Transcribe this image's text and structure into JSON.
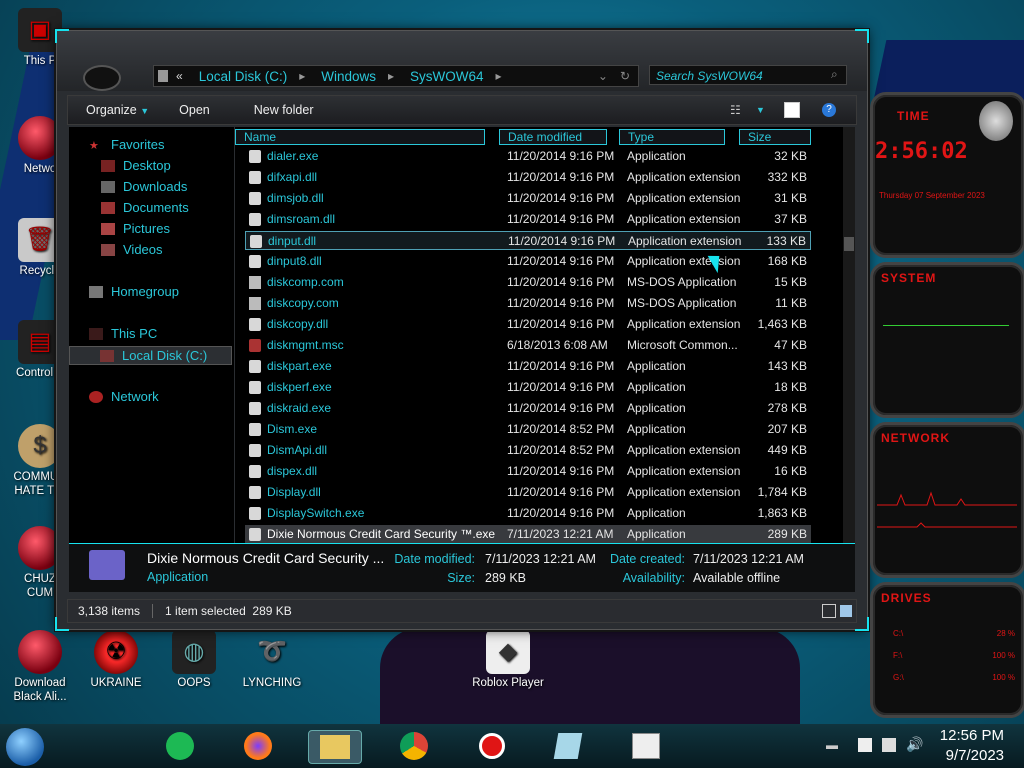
{
  "desktop": {
    "icons": [
      {
        "label": "This P",
        "sub": ""
      },
      {
        "label": "Netwo",
        "sub": ""
      },
      {
        "label": "Recycle",
        "sub": ""
      },
      {
        "label": "Control P",
        "sub": ""
      },
      {
        "label": "COMMUN",
        "sub": "HATE THI"
      },
      {
        "label": "CHUZ",
        "sub": "CUM"
      },
      {
        "label": "Download",
        "sub": "Black Ali..."
      },
      {
        "label": "UKRAINE",
        "sub": ""
      },
      {
        "label": "OOPS",
        "sub": ""
      },
      {
        "label": "LYNCHING",
        "sub": ""
      },
      {
        "label": "Roblox Player",
        "sub": ""
      }
    ]
  },
  "explorer": {
    "breadcrumb": {
      "root_arrow": "«",
      "segments": [
        "Local Disk (C:)",
        "Windows",
        "SysWOW64"
      ]
    },
    "search_placeholder": "Search SysWOW64",
    "toolbar": {
      "organize": "Organize",
      "open": "Open",
      "new_folder": "New folder"
    },
    "nav": {
      "favorites": "Favorites",
      "desktop": "Desktop",
      "downloads": "Downloads",
      "documents": "Documents",
      "pictures": "Pictures",
      "videos": "Videos",
      "homegroup": "Homegroup",
      "this_pc": "This PC",
      "local_disk": "Local Disk (C:)",
      "network": "Network"
    },
    "columns": {
      "name": "Name",
      "date": "Date modified",
      "type": "Type",
      "size": "Size"
    },
    "files": [
      {
        "name": "dialer.exe",
        "date": "11/20/2014 9:16 PM",
        "type": "Application",
        "size": "32 KB",
        "kind": "exe"
      },
      {
        "name": "difxapi.dll",
        "date": "11/20/2014 9:16 PM",
        "type": "Application extension",
        "size": "332 KB",
        "kind": "dll"
      },
      {
        "name": "dimsjob.dll",
        "date": "11/20/2014 9:16 PM",
        "type": "Application extension",
        "size": "31 KB",
        "kind": "dll"
      },
      {
        "name": "dimsroam.dll",
        "date": "11/20/2014 9:16 PM",
        "type": "Application extension",
        "size": "37 KB",
        "kind": "dll"
      },
      {
        "name": "dinput.dll",
        "date": "11/20/2014 9:16 PM",
        "type": "Application extension",
        "size": "133 KB",
        "kind": "dll"
      },
      {
        "name": "dinput8.dll",
        "date": "11/20/2014 9:16 PM",
        "type": "Application extension",
        "size": "168 KB",
        "kind": "dll"
      },
      {
        "name": "diskcomp.com",
        "date": "11/20/2014 9:16 PM",
        "type": "MS-DOS Application",
        "size": "15 KB",
        "kind": "com"
      },
      {
        "name": "diskcopy.com",
        "date": "11/20/2014 9:16 PM",
        "type": "MS-DOS Application",
        "size": "11 KB",
        "kind": "com"
      },
      {
        "name": "diskcopy.dll",
        "date": "11/20/2014 9:16 PM",
        "type": "Application extension",
        "size": "1,463 KB",
        "kind": "dll"
      },
      {
        "name": "diskmgmt.msc",
        "date": "6/18/2013 6:08 AM",
        "type": "Microsoft Common...",
        "size": "47 KB",
        "kind": "msc"
      },
      {
        "name": "diskpart.exe",
        "date": "11/20/2014 9:16 PM",
        "type": "Application",
        "size": "143 KB",
        "kind": "exe"
      },
      {
        "name": "diskperf.exe",
        "date": "11/20/2014 9:16 PM",
        "type": "Application",
        "size": "18 KB",
        "kind": "exe"
      },
      {
        "name": "diskraid.exe",
        "date": "11/20/2014 9:16 PM",
        "type": "Application",
        "size": "278 KB",
        "kind": "exe"
      },
      {
        "name": "Dism.exe",
        "date": "11/20/2014 8:52 PM",
        "type": "Application",
        "size": "207 KB",
        "kind": "exe"
      },
      {
        "name": "DismApi.dll",
        "date": "11/20/2014 8:52 PM",
        "type": "Application extension",
        "size": "449 KB",
        "kind": "dll"
      },
      {
        "name": "dispex.dll",
        "date": "11/20/2014 9:16 PM",
        "type": "Application extension",
        "size": "16 KB",
        "kind": "dll"
      },
      {
        "name": "Display.dll",
        "date": "11/20/2014 9:16 PM",
        "type": "Application extension",
        "size": "1,784 KB",
        "kind": "dll"
      },
      {
        "name": "DisplaySwitch.exe",
        "date": "11/20/2014 9:16 PM",
        "type": "Application",
        "size": "1,863 KB",
        "kind": "exe"
      },
      {
        "name": "Dixie Normous Credit Card Security ™.exe",
        "date": "7/11/2023 12:21 AM",
        "type": "Application",
        "size": "289 KB",
        "kind": "exe"
      }
    ],
    "details": {
      "name": "Dixie Normous Credit Card Security ...",
      "kind": "Application",
      "date_modified_label": "Date modified:",
      "date_modified": "7/11/2023 12:21 AM",
      "size_label": "Size:",
      "size": "289 KB",
      "date_created_label": "Date created:",
      "date_created": "7/11/2023 12:21 AM",
      "availability_label": "Availability:",
      "availability": "Available offline"
    },
    "status": {
      "count": "3,138 items",
      "selection": "1 item selected  289 KB"
    }
  },
  "gadgets": {
    "time_title": "TIME",
    "time_value": "2:56:02",
    "date_text": "Thursday 07 September 2023",
    "system_title": "SYSTEM",
    "network_title": "NETWORK",
    "drives_title": "DRIVES",
    "drive_labels": [
      "C:\\",
      "F:\\",
      "G:\\"
    ],
    "drive_pct": [
      "28 %",
      "100 %",
      "100 %"
    ]
  },
  "taskbar": {
    "time": "12:56 PM",
    "date": "9/7/2023"
  },
  "colors": {
    "accent": "#2bc7d9",
    "gadget_red": "#e01515"
  }
}
